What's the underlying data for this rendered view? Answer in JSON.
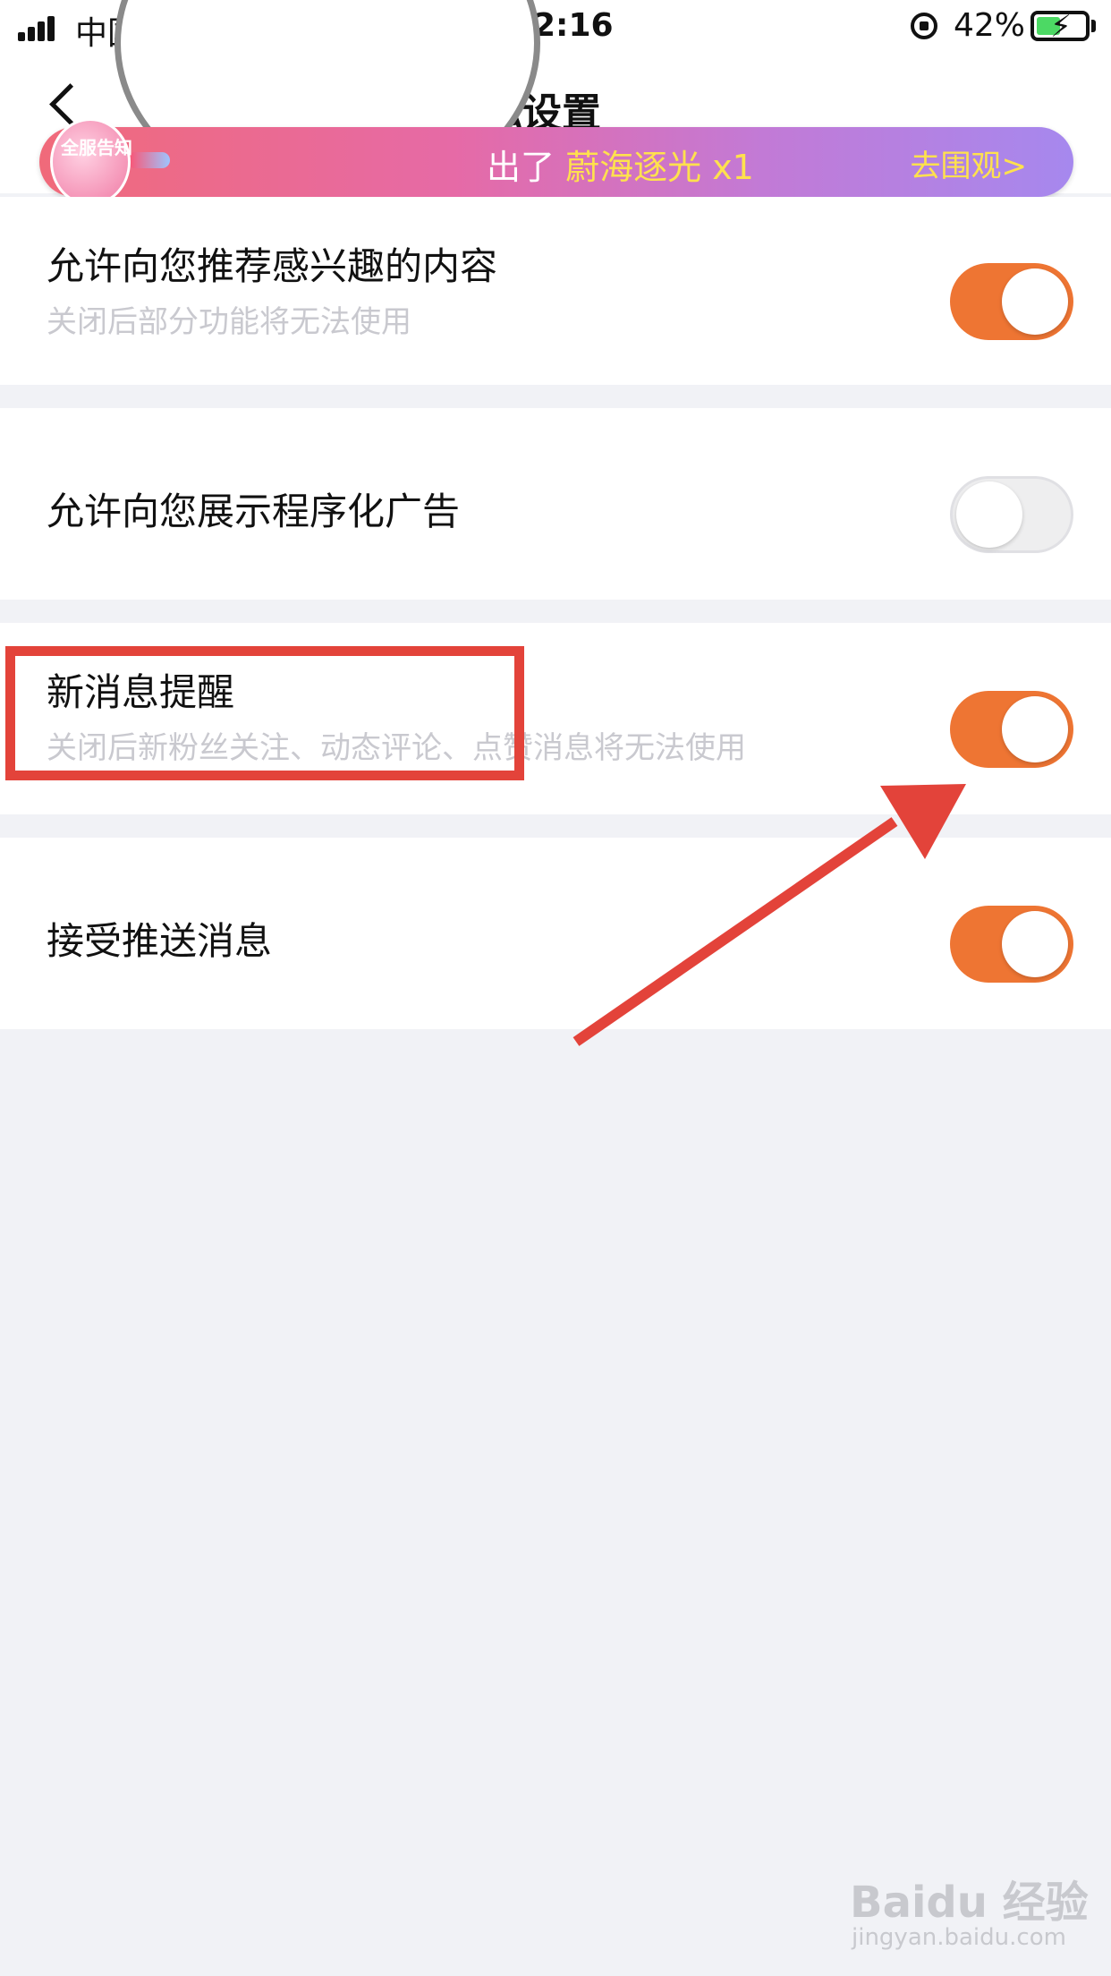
{
  "status_bar": {
    "carrier": "中国",
    "time": "2:16",
    "battery_percent": "42%"
  },
  "nav": {
    "title": "私设置"
  },
  "banner": {
    "rocket_label": "全服告知",
    "text_prefix": "出了",
    "highlight": "蔚海逐光 x1",
    "link": "去围观>"
  },
  "settings": [
    {
      "title": "允许向您推荐感兴趣的内容",
      "subtitle": "关闭后部分功能将无法使用",
      "enabled": true
    },
    {
      "title": "允许向您展示程序化广告",
      "subtitle": "",
      "enabled": false
    },
    {
      "title": "新消息提醒",
      "subtitle": "关闭后新粉丝关注、动态评论、点赞消息将无法使用",
      "enabled": true
    },
    {
      "title": "接受推送消息",
      "subtitle": "",
      "enabled": true
    }
  ],
  "annotation_color": "#e3433a",
  "accent_color": "#ee7533",
  "watermark": {
    "brand": "Baidu 经验",
    "url": "jingyan.baidu.com"
  }
}
